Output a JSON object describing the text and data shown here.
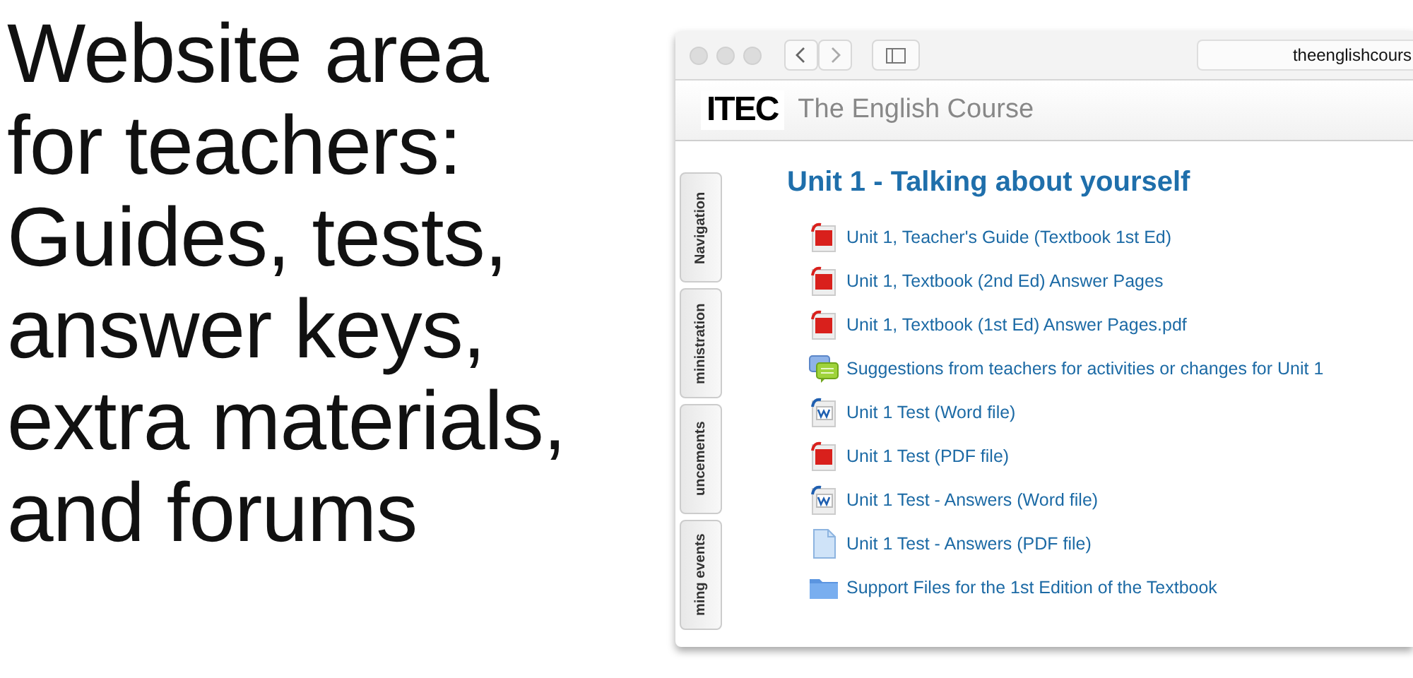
{
  "headline": {
    "lines": [
      "Website area",
      "for teachers:",
      "Guides, tests,",
      "answer keys,",
      "extra materials,",
      "and forums"
    ]
  },
  "browser": {
    "url": "theenglishcours",
    "site": {
      "logo": "ITEC",
      "name": "The English Course"
    },
    "side_tabs": [
      {
        "label": "Navigation"
      },
      {
        "label": "ministration"
      },
      {
        "label": "uncements"
      },
      {
        "label": "ming events"
      }
    ],
    "section_title": "Unit 1 - Talking about yourself",
    "resources": [
      {
        "kind": "pdf",
        "label": "Unit 1, Teacher's Guide (Textbook 1st Ed)"
      },
      {
        "kind": "pdf",
        "label": "Unit 1, Textbook (2nd Ed) Answer Pages"
      },
      {
        "kind": "pdf",
        "label": "Unit 1, Textbook (1st Ed) Answer Pages.pdf"
      },
      {
        "kind": "forum",
        "label": "Suggestions from teachers for activities or changes for Unit 1"
      },
      {
        "kind": "word",
        "label": "Unit 1 Test (Word file)"
      },
      {
        "kind": "pdf",
        "label": "Unit 1 Test (PDF file)"
      },
      {
        "kind": "word",
        "label": "Unit 1 Test - Answers (Word file)"
      },
      {
        "kind": "file",
        "label": "Unit 1 Test - Answers (PDF file)"
      },
      {
        "kind": "folder",
        "label": "Support Files for the 1st Edition of the Textbook"
      }
    ]
  }
}
